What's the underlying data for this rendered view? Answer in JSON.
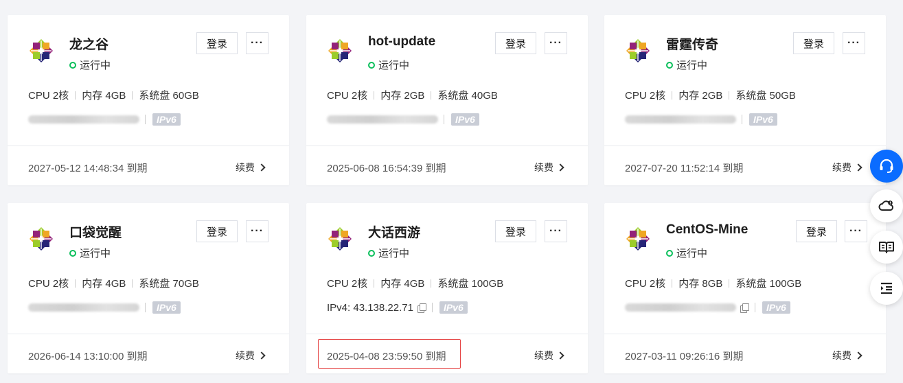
{
  "cards": [
    {
      "name": "龙之谷",
      "status": "运行中",
      "cpu": "CPU 2核",
      "mem": "内存 4GB",
      "disk": "系统盘 60GB",
      "ipv4": "",
      "ipv6": "IPv6",
      "expire": "2027-05-12 14:48:34 到期",
      "login": "登录",
      "more": "···",
      "renew": "续费"
    },
    {
      "name": "hot-update",
      "status": "运行中",
      "cpu": "CPU 2核",
      "mem": "内存 2GB",
      "disk": "系统盘 40GB",
      "ipv4": "",
      "ipv6": "IPv6",
      "expire": "2025-06-08 16:54:39 到期",
      "login": "登录",
      "more": "···",
      "renew": "续费"
    },
    {
      "name": "雷霆传奇",
      "status": "运行中",
      "cpu": "CPU 2核",
      "mem": "内存 2GB",
      "disk": "系统盘 50GB",
      "ipv4": "",
      "ipv6": "IPv6",
      "expire": "2027-07-20 11:52:14 到期",
      "login": "登录",
      "more": "···",
      "renew": "续费"
    },
    {
      "name": "口袋觉醒",
      "status": "运行中",
      "cpu": "CPU 2核",
      "mem": "内存 4GB",
      "disk": "系统盘 70GB",
      "ipv4": "",
      "ipv6": "IPv6",
      "expire": "2026-06-14 13:10:00 到期",
      "login": "登录",
      "more": "···",
      "renew": "续费"
    },
    {
      "name": "大话西游",
      "status": "运行中",
      "cpu": "CPU 2核",
      "mem": "内存 4GB",
      "disk": "系统盘 100GB",
      "ipv4": "IPv4: 43.138.22.71",
      "ipv6": "IPv6",
      "expire": "2025-04-08 23:59:50 到期",
      "login": "登录",
      "more": "···",
      "renew": "续费"
    },
    {
      "name": "CentOS-Mine",
      "status": "运行中",
      "cpu": "CPU 2核",
      "mem": "内存 8GB",
      "disk": "系统盘 100GB",
      "ipv4": "",
      "ipv6": "IPv6",
      "expire": "2027-03-11 09:26:16 到期",
      "login": "登录",
      "more": "···",
      "renew": "续费"
    }
  ],
  "colors": {
    "running": "#0abf5b",
    "accent": "#0a6cff",
    "highlight": "#e54545"
  },
  "float_bar": [
    "headset-icon",
    "cloud-alert-icon",
    "book-icon",
    "list-indent-icon"
  ]
}
